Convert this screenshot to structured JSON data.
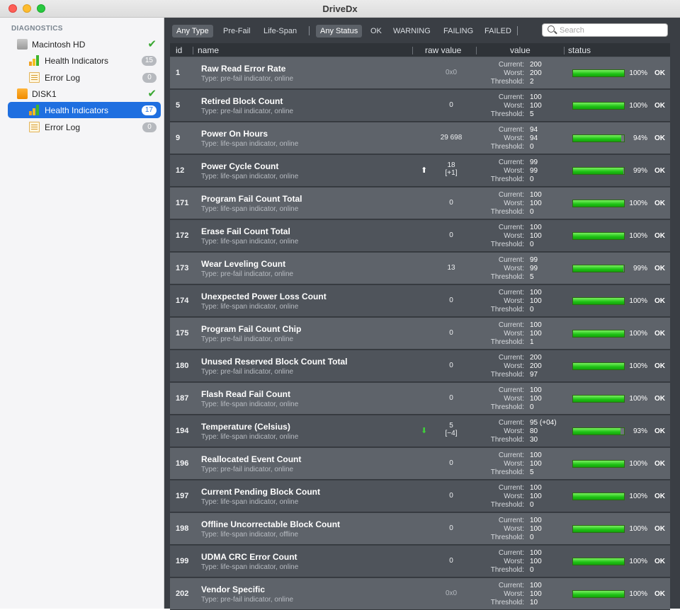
{
  "window": {
    "title": "DriveDx"
  },
  "sidebar": {
    "heading": "DIAGNOSTICS",
    "items": [
      {
        "label": "Macintosh HD",
        "icon": "disk-icon",
        "status": "ok"
      },
      {
        "label": "Health Indicators",
        "icon": "bar-chart-icon",
        "badge": "15"
      },
      {
        "label": "Error Log",
        "icon": "document-icon",
        "badge": "0"
      },
      {
        "label": "DISK1",
        "icon": "disk-icon",
        "status": "ok"
      },
      {
        "label": "Health Indicators",
        "icon": "bar-chart-icon",
        "badge": "17",
        "selected": true
      },
      {
        "label": "Error Log",
        "icon": "document-icon",
        "badge": "0"
      }
    ]
  },
  "filters": {
    "type": [
      "Any Type",
      "Pre-Fail",
      "Life-Span"
    ],
    "status": [
      "Any Status",
      "OK",
      "WARNING",
      "FAILING",
      "FAILED"
    ],
    "active_type": "Any Type",
    "active_status": "Any Status"
  },
  "search": {
    "placeholder": "Search"
  },
  "columns": {
    "id": "id",
    "name": "name",
    "raw": "raw value",
    "value": "value",
    "status": "status"
  },
  "value_labels": {
    "current": "Current:",
    "worst": "Worst:",
    "threshold": "Threshold:"
  },
  "rows": [
    {
      "id": "1",
      "name": "Raw Read Error Rate",
      "type": "Type: pre-fail indicator, online",
      "raw": "0x0",
      "current": "200",
      "worst": "200",
      "threshold": "2",
      "pct": 100,
      "pct_text": "100%",
      "status": "OK"
    },
    {
      "id": "5",
      "name": "Retired Block Count",
      "type": "Type: pre-fail indicator, online",
      "raw": "0",
      "current": "100",
      "worst": "100",
      "threshold": "5",
      "pct": 100,
      "pct_text": "100%",
      "status": "OK"
    },
    {
      "id": "9",
      "name": "Power On Hours",
      "type": "Type: life-span indicator, online",
      "raw": "29 698",
      "current": "94",
      "worst": "94",
      "threshold": "0",
      "pct": 94,
      "pct_text": "94%",
      "status": "OK"
    },
    {
      "id": "12",
      "name": "Power Cycle Count",
      "type": "Type: life-span indicator, online",
      "raw": "18",
      "raw2": "[+1]",
      "arrow": "up",
      "current": "99",
      "worst": "99",
      "threshold": "0",
      "pct": 99,
      "pct_text": "99%",
      "status": "OK"
    },
    {
      "id": "171",
      "name": "Program Fail Count Total",
      "type": "Type: life-span indicator, online",
      "raw": "0",
      "current": "100",
      "worst": "100",
      "threshold": "0",
      "pct": 100,
      "pct_text": "100%",
      "status": "OK"
    },
    {
      "id": "172",
      "name": "Erase Fail Count Total",
      "type": "Type: life-span indicator, online",
      "raw": "0",
      "current": "100",
      "worst": "100",
      "threshold": "0",
      "pct": 100,
      "pct_text": "100%",
      "status": "OK"
    },
    {
      "id": "173",
      "name": "Wear Leveling Count",
      "type": "Type: pre-fail indicator, online",
      "raw": "13",
      "current": "99",
      "worst": "99",
      "threshold": "5",
      "pct": 99,
      "pct_text": "99%",
      "status": "OK"
    },
    {
      "id": "174",
      "name": "Unexpected Power Loss Count",
      "type": "Type: life-span indicator, online",
      "raw": "0",
      "current": "100",
      "worst": "100",
      "threshold": "0",
      "pct": 100,
      "pct_text": "100%",
      "status": "OK"
    },
    {
      "id": "175",
      "name": "Program Fail Count Chip",
      "type": "Type: pre-fail indicator, online",
      "raw": "0",
      "current": "100",
      "worst": "100",
      "threshold": "1",
      "pct": 100,
      "pct_text": "100%",
      "status": "OK"
    },
    {
      "id": "180",
      "name": "Unused Reserved Block Count Total",
      "type": "Type: pre-fail indicator, online",
      "raw": "0",
      "current": "200",
      "worst": "200",
      "threshold": "97",
      "pct": 100,
      "pct_text": "100%",
      "status": "OK"
    },
    {
      "id": "187",
      "name": "Flash Read Fail Count",
      "type": "Type: life-span indicator, online",
      "raw": "0",
      "current": "100",
      "worst": "100",
      "threshold": "0",
      "pct": 100,
      "pct_text": "100%",
      "status": "OK"
    },
    {
      "id": "194",
      "name": "Temperature (Celsius)",
      "type": "Type: life-span indicator, online",
      "raw": "5",
      "raw2": "[−4]",
      "arrow": "down",
      "current": "95  (+04)",
      "worst": "80",
      "threshold": "30",
      "pct": 93,
      "pct_text": "93%",
      "status": "OK"
    },
    {
      "id": "196",
      "name": "Reallocated Event Count",
      "type": "Type: pre-fail indicator, online",
      "raw": "0",
      "current": "100",
      "worst": "100",
      "threshold": "5",
      "pct": 100,
      "pct_text": "100%",
      "status": "OK"
    },
    {
      "id": "197",
      "name": "Current Pending Block Count",
      "type": "Type: life-span indicator, online",
      "raw": "0",
      "current": "100",
      "worst": "100",
      "threshold": "0",
      "pct": 100,
      "pct_text": "100%",
      "status": "OK"
    },
    {
      "id": "198",
      "name": "Offline Uncorrectable Block Count",
      "type": "Type: life-span indicator, offline",
      "raw": "0",
      "current": "100",
      "worst": "100",
      "threshold": "0",
      "pct": 100,
      "pct_text": "100%",
      "status": "OK"
    },
    {
      "id": "199",
      "name": "UDMA CRC Error Count",
      "type": "Type: life-span indicator, online",
      "raw": "0",
      "current": "100",
      "worst": "100",
      "threshold": "0",
      "pct": 100,
      "pct_text": "100%",
      "status": "OK"
    },
    {
      "id": "202",
      "name": "Vendor Specific",
      "type": "Type: pre-fail indicator, online",
      "raw": "0x0",
      "current": "100",
      "worst": "100",
      "threshold": "10",
      "pct": 100,
      "pct_text": "100%",
      "status": "OK"
    }
  ]
}
